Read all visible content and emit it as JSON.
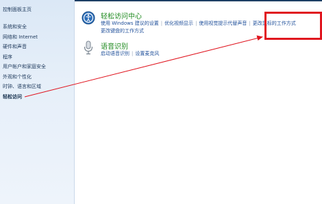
{
  "sidebar": {
    "home": "控制面板主页",
    "items": [
      {
        "label": "系统和安全"
      },
      {
        "label": "网络和 Internet"
      },
      {
        "label": "硬件和声音"
      },
      {
        "label": "程序"
      },
      {
        "label": "用户帐户和家庭安全"
      },
      {
        "label": "外观和个性化"
      },
      {
        "label": "时钟、语言和区域"
      },
      {
        "label": "轻松访问"
      }
    ]
  },
  "sections": [
    {
      "title": "轻松访问中心",
      "icon": "ease-of-access-icon",
      "links_row1": [
        "使用 Windows 建议的设置",
        "优化视频显示",
        "使用视觉提示代替声音",
        "更改鼠标的工作方式"
      ],
      "links_row2": [
        "更改键盘的工作方式"
      ]
    },
    {
      "title": "语音识别",
      "icon": "microphone-icon",
      "links_row1": [
        "启动语音识别",
        "设置麦克风"
      ]
    }
  ],
  "annotation": {
    "box_color": "#e0141e",
    "arrow_color": "#e0141e"
  }
}
